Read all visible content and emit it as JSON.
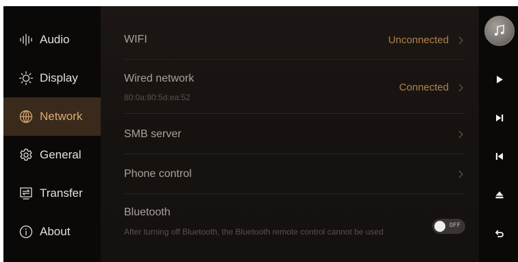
{
  "sidebar": {
    "items": [
      {
        "label": "Audio",
        "icon": "audio-waveform-icon",
        "active": false
      },
      {
        "label": "Display",
        "icon": "sun-icon",
        "active": false
      },
      {
        "label": "Network",
        "icon": "globe-icon",
        "active": true
      },
      {
        "label": "General",
        "icon": "gear-icon",
        "active": false
      },
      {
        "label": "Transfer",
        "icon": "transfer-icon",
        "active": false
      },
      {
        "label": "About",
        "icon": "info-icon",
        "active": false
      }
    ]
  },
  "network": {
    "wifi": {
      "title": "WIFI",
      "status": "Unconnected",
      "status_color": "#b3824f"
    },
    "wired": {
      "title": "Wired network",
      "subtitle": "80:0a:80:5d:ea:52",
      "status": "Connected",
      "status_color": "#b3824f"
    },
    "smb": {
      "title": "SMB server"
    },
    "phone": {
      "title": "Phone control"
    },
    "bluetooth": {
      "title": "Bluetooth",
      "description": "After turning off Bluetooth, the Bluetooth remote control cannot be used",
      "toggle_label": "OFF",
      "enabled": false
    }
  },
  "controls": {
    "music": "music-note-icon",
    "play": "play-icon",
    "next": "next-track-icon",
    "prev": "previous-track-icon",
    "eject": "eject-icon",
    "back": "back-icon"
  },
  "colors": {
    "accent": "#d9aa72",
    "active_bg": "#3a2a1b",
    "status": "#b3824f"
  }
}
